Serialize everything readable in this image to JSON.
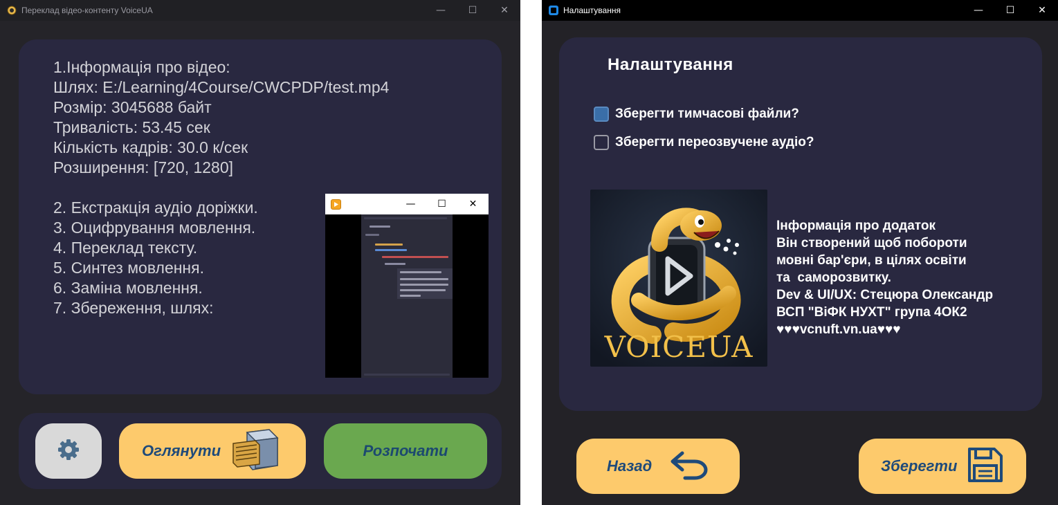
{
  "main_window": {
    "title": "Переклад відео-контенту VoiceUA",
    "controls": {
      "minimize": "—",
      "maximize": "☐",
      "close": "✕"
    },
    "info_lines": [
      "1.Інформація про відео:",
      "Шлях: E:/Learning/4Course/CWCPDP/test.mp4",
      "Розмір: 3045688 байт",
      "Тривалість: 53.45 сек",
      "Кількість кадрів: 30.0 к/сек",
      "Розширення: [720, 1280]"
    ],
    "steps": [
      "2. Екстракція аудіо доріжки.",
      "3. Оцифрування мовлення.",
      "4. Переклад тексту.",
      "5. Синтез мовлення.",
      "6. Заміна мовлення.",
      "7. Збереження, шлях:"
    ],
    "preview_window": {
      "controls": {
        "minimize": "—",
        "maximize": "☐",
        "close": "✕"
      }
    },
    "buttons": {
      "settings_icon": "gear-icon",
      "browse_label": "Оглянути",
      "browse_icon": "file-cabinet-icon",
      "start_label": "Розпочати"
    }
  },
  "settings_window": {
    "title": "Налаштування",
    "controls": {
      "minimize": "—",
      "maximize": "☐",
      "close": "✕"
    },
    "heading": "Налаштування",
    "options": [
      {
        "label": "Зберегти тимчасові файли?",
        "checked": true
      },
      {
        "label": "Зберегти переозвучене аудіо?",
        "checked": false
      }
    ],
    "logo_text": "VOICEUA",
    "about_lines": [
      "Інформація про додаток",
      "Він створений щоб побороти",
      "мовні бар'єри, в цілях освіти",
      "та  саморозвитку.",
      "Dev & UI/UX: Стецюра Олександр",
      "ВСП \"ВіФК НУХТ\" група 4ОК2",
      "♥♥♥vcnuft.vn.ua♥♥♥"
    ],
    "buttons": {
      "back_label": "Назад",
      "back_icon": "return-arrow-icon",
      "save_label": "Зберегти",
      "save_icon": "floppy-disk-icon"
    }
  },
  "colors": {
    "background": "#252429",
    "panel": "#292840",
    "button_yellow": "#fdca6c",
    "button_green": "#6aa84f",
    "button_gray": "#d9d9d9",
    "button_text": "#1e4a7a",
    "checkbox_checked": "#3a6ea8"
  }
}
